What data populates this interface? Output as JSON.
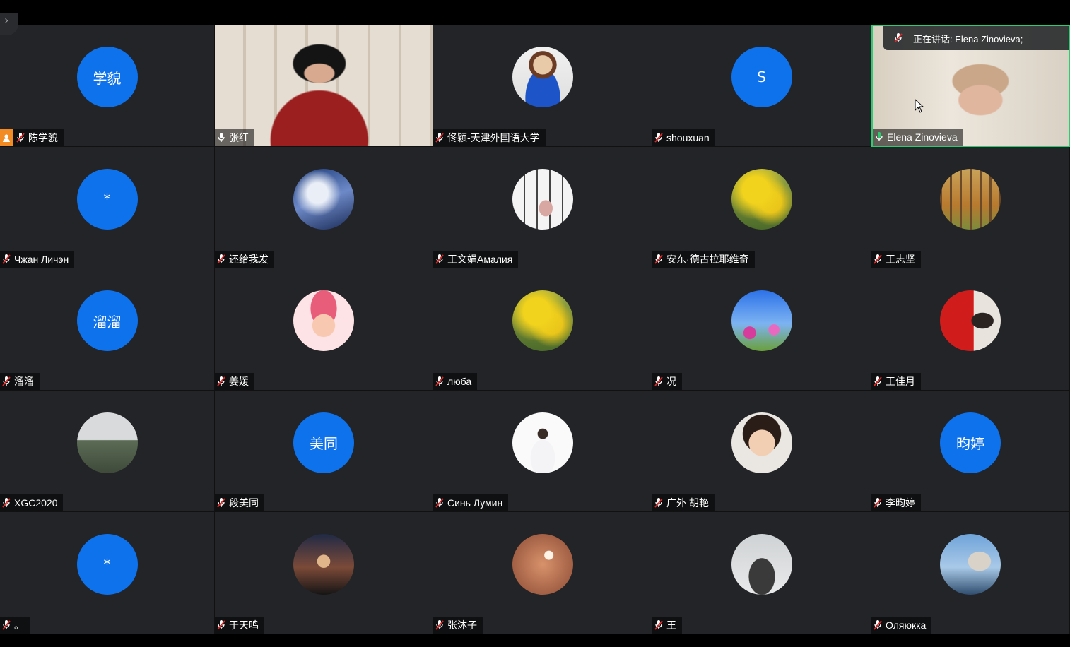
{
  "meeting": {
    "active_speaker": {
      "label": "正在讲话: Elena Zinovieva;"
    }
  },
  "colors": {
    "avatar_blue": "#0e72ed",
    "tile_bg": "#232427",
    "speaking_border": "#2ecc71",
    "host_badge": "#f28b24"
  },
  "participants": [
    {
      "name": "陈学貌",
      "avatar_text": "学貌",
      "avatar_kind": "text",
      "mic": "muted",
      "host": true
    },
    {
      "name": "张红",
      "avatar_kind": "video",
      "mic": "on"
    },
    {
      "name": "佟颖-天津外国语大学",
      "avatar_kind": "photo",
      "photo": "woman-blue",
      "mic": "muted"
    },
    {
      "name": "shouxuan",
      "avatar_text": "S",
      "avatar_kind": "text",
      "mic": "muted"
    },
    {
      "name": "Elena Zinovieva",
      "avatar_kind": "video",
      "mic": "speaking"
    },
    {
      "name": "Чжан Личэн",
      "avatar_text": "*",
      "avatar_kind": "text",
      "mic": "muted"
    },
    {
      "name": "还给我发",
      "avatar_kind": "photo",
      "photo": "snow-tree",
      "mic": "muted"
    },
    {
      "name": "王文娟Амалия",
      "avatar_kind": "photo",
      "photo": "dancer",
      "mic": "muted"
    },
    {
      "name": "安东·德古拉耶维奇",
      "avatar_kind": "photo",
      "photo": "yellow-flowers",
      "mic": "muted"
    },
    {
      "name": "王志坚",
      "avatar_kind": "photo",
      "photo": "autumn-forest",
      "mic": "muted"
    },
    {
      "name": "溜溜",
      "avatar_text": "溜溜",
      "avatar_kind": "text",
      "mic": "muted"
    },
    {
      "name": "姜媛",
      "avatar_kind": "photo",
      "photo": "cartoon",
      "mic": "muted"
    },
    {
      "name": "люба",
      "avatar_kind": "photo",
      "photo": "yellow-flowers",
      "mic": "muted"
    },
    {
      "name": "况",
      "avatar_kind": "photo",
      "photo": "cosmos",
      "mic": "muted"
    },
    {
      "name": "王佳月",
      "avatar_kind": "photo",
      "photo": "flag-person",
      "mic": "muted"
    },
    {
      "name": "XGC2020",
      "avatar_kind": "photo",
      "photo": "landscape",
      "mic": "muted"
    },
    {
      "name": "段美同",
      "avatar_text": "美同",
      "avatar_kind": "text",
      "mic": "muted"
    },
    {
      "name": "Синь Лумин",
      "avatar_kind": "photo",
      "photo": "white-person",
      "mic": "muted"
    },
    {
      "name": "广外 胡艳",
      "avatar_kind": "photo",
      "photo": "child",
      "mic": "muted"
    },
    {
      "name": "李昀婷",
      "avatar_text": "昀婷",
      "avatar_kind": "text",
      "mic": "muted"
    },
    {
      "name": "。",
      "avatar_text": "*",
      "avatar_kind": "text",
      "mic": "muted"
    },
    {
      "name": "于天鸣",
      "avatar_kind": "photo",
      "photo": "sunset-person",
      "mic": "muted"
    },
    {
      "name": "张沐子",
      "avatar_kind": "photo",
      "photo": "heart-bokeh",
      "mic": "muted"
    },
    {
      "name": "王",
      "avatar_kind": "photo",
      "photo": "ink-landscape",
      "mic": "muted"
    },
    {
      "name": "Оляюкка",
      "avatar_kind": "photo",
      "photo": "seaside-church",
      "mic": "muted"
    }
  ]
}
